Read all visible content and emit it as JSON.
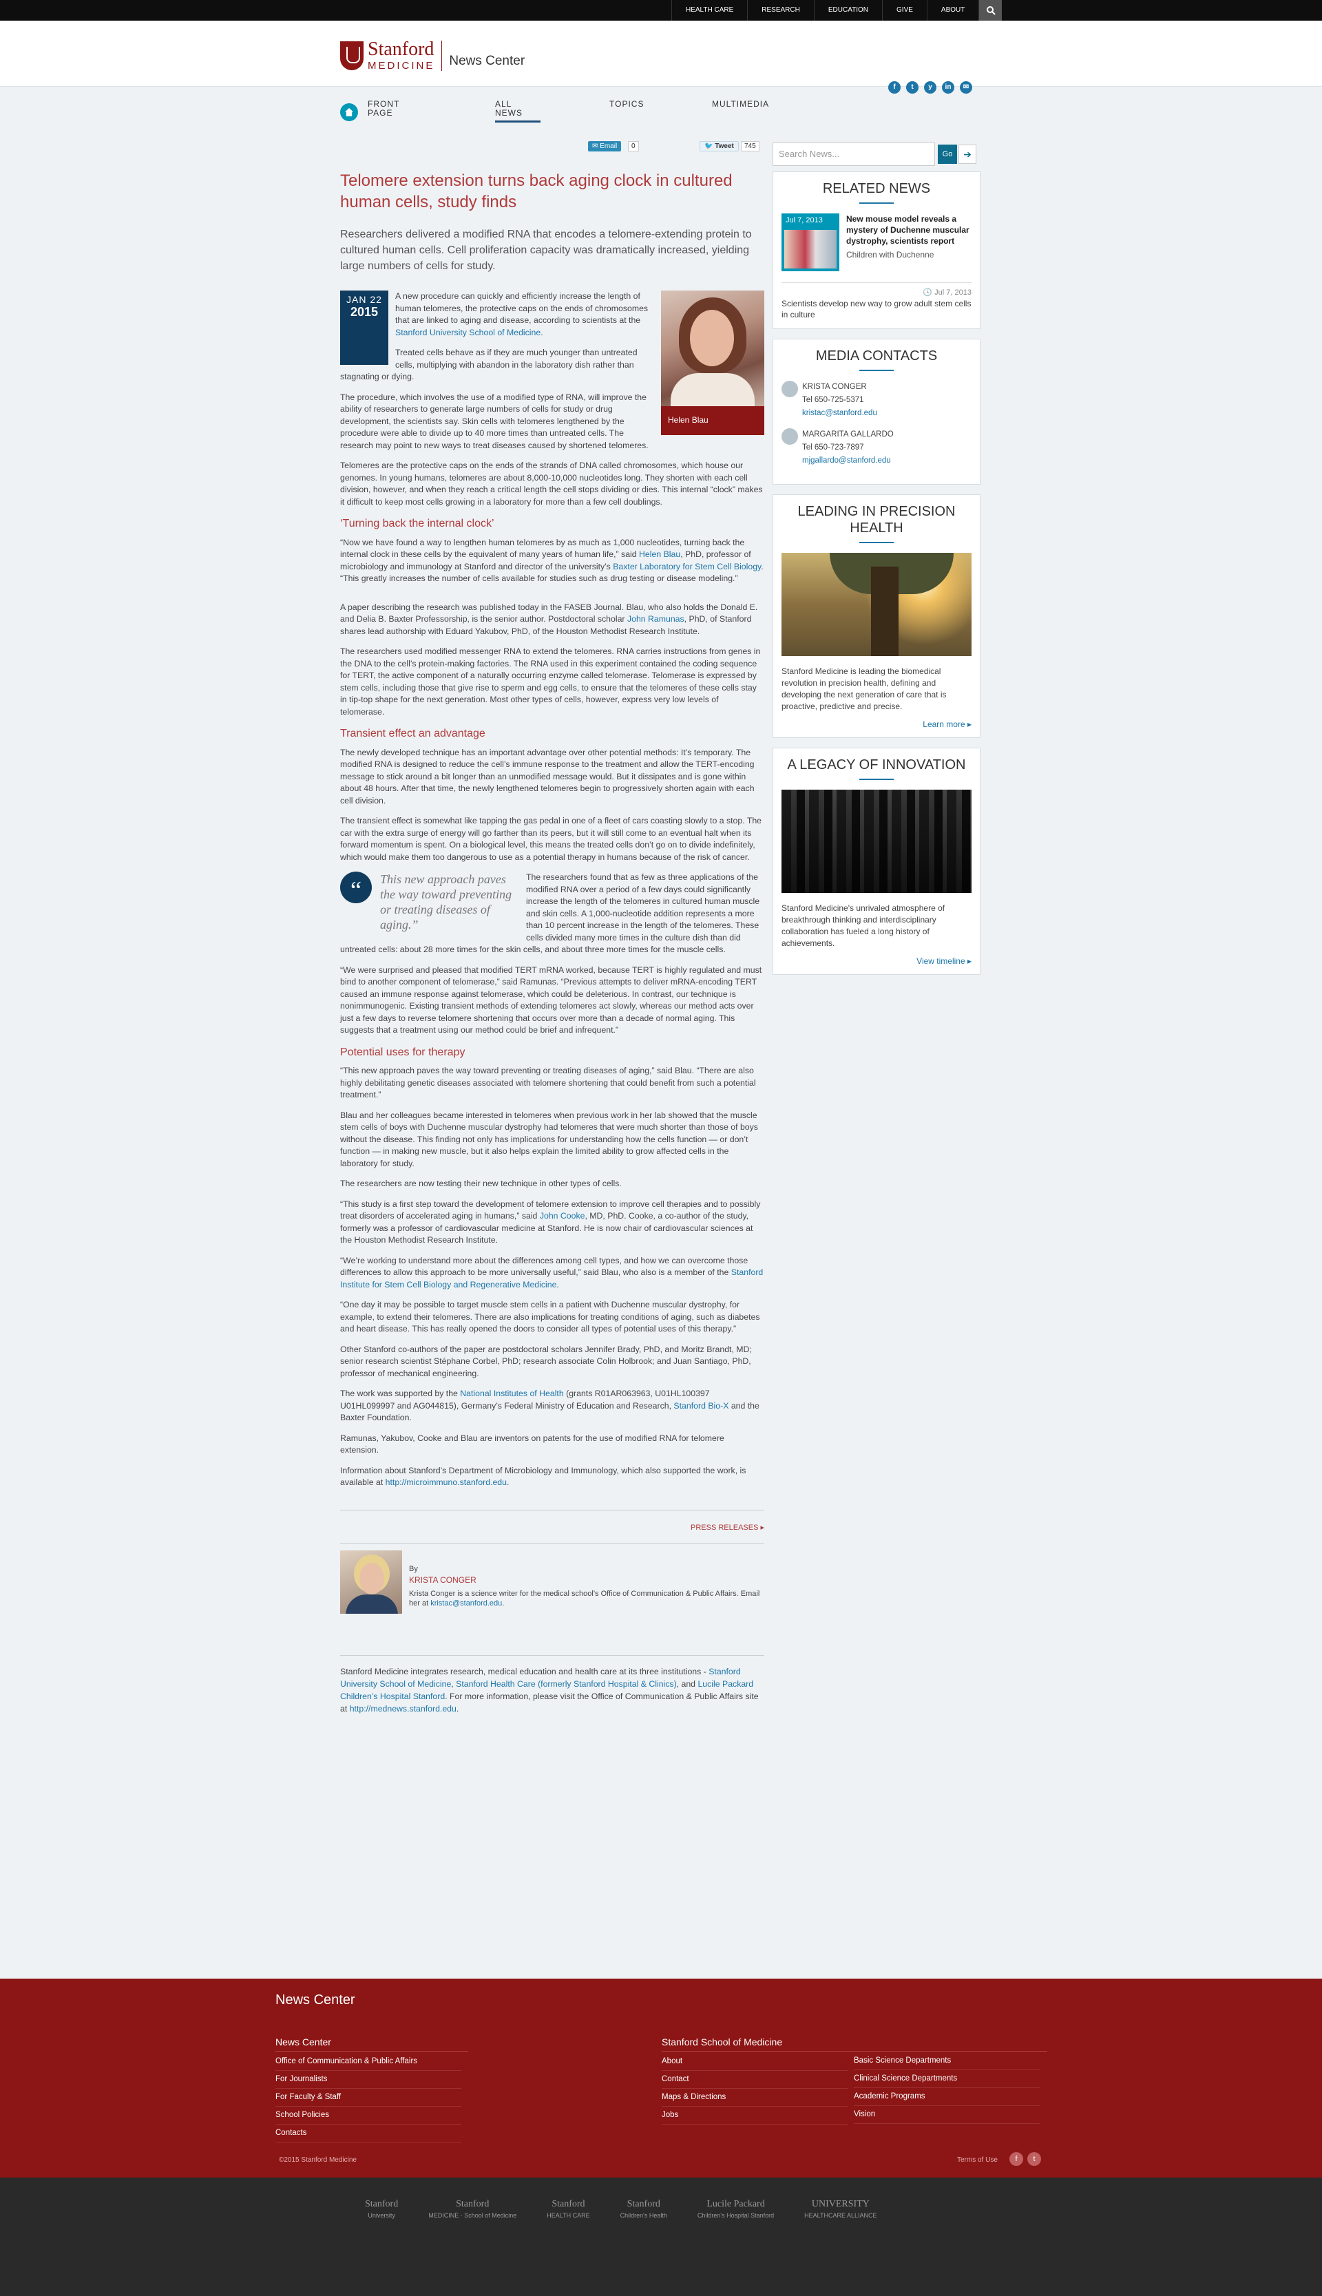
{
  "topnav": [
    "HEALTH CARE",
    "RESEARCH",
    "EDUCATION",
    "GIVE",
    "ABOUT"
  ],
  "logo": {
    "line1": "Stanford",
    "line2": "MEDICINE",
    "section": "News Center"
  },
  "social": [
    "f",
    "t",
    "y",
    "in",
    "✉"
  ],
  "nav": {
    "front_page": "FRONT PAGE",
    "all_news": "ALL NEWS",
    "topics": "TOPICS",
    "multimedia": "MULTIMEDIA"
  },
  "share": {
    "email": "Email",
    "email_count": "0",
    "tweet": "Tweet",
    "tweet_count": "745"
  },
  "article": {
    "title": "Telomere extension turns back aging clock in cultured human cells, study finds",
    "lede": "Researchers delivered a modified RNA that encodes a telomere-extending protein to cultured human cells. Cell proliferation capacity was dramatically increased, yielding large numbers of cells for study.",
    "date_md": "JAN 22",
    "date_yr": "2015",
    "photo_caption": "Helen Blau",
    "p1a": "A new procedure can quickly and efficiently increase the length of human telomeres, the protective caps on the ends of chromosomes that are linked to aging and disease, according to scientists at the ",
    "p1_link": "Stanford University School of Medicine",
    "p1b": ".",
    "p2": "Treated cells behave as if they are much younger than untreated cells, multiplying with abandon in the laboratory dish rather than stagnating or dying.",
    "p3": "The procedure, which involves the use of a modified type of RNA, will improve the ability of researchers to generate large numbers of cells for study or drug development, the scientists say. Skin cells with telomeres lengthened by the procedure were able to divide up to 40 more times than untreated cells. The research may point to new ways to treat diseases caused by shortened telomeres.",
    "p4": "Telomeres are the protective caps on the ends of the strands of DNA called chromosomes, which house our genomes. In young humans, telomeres are about 8,000-10,000 nucleotides long. They shorten with each cell division, however, and when they reach a critical length the cell stops dividing or dies. This internal “clock” makes it difficult to keep most cells growing in a laboratory for more than a few cell doublings.",
    "h_clock": "‘Turning back the internal clock’",
    "p5a": "“Now we have found a way to lengthen human telomeres by as much as 1,000 nucleotides, turning back the internal clock in these cells by the equivalent of many years of human life,” said ",
    "p5_link1": "Helen Blau",
    "p5b": ", PhD, professor of microbiology and immunology at Stanford and director of the university’s ",
    "p5_link2": "Baxter Laboratory for Stem Cell Biology",
    "p5c": ". “This greatly increases the number of cells available for studies such as drug testing or disease modeling.”",
    "p6a": "A paper describing the research was published today in the FASEB Journal. Blau, who also holds the Donald E. and Delia B. Baxter Professorship, is the senior author. Postdoctoral scholar ",
    "p6_link": "John Ramunas",
    "p6b": ", PhD, of Stanford shares lead authorship with Eduard Yakubov, PhD, of the Houston Methodist Research Institute.",
    "p7": "The researchers used modified messenger RNA to extend the telomeres. RNA carries instructions from genes in the DNA to the cell’s protein-making factories. The RNA used in this experiment contained the coding sequence for TERT, the active component of a naturally occurring enzyme called telomerase. Telomerase is expressed by stem cells, including those that give rise to sperm and egg cells, to ensure that the telomeres of these cells stay in tip-top shape for the next generation. Most other types of cells, however, express very low levels of telomerase.",
    "h_transient": "Transient effect an advantage",
    "p8": "The newly developed technique has an important advantage over other potential methods: It’s temporary. The modified RNA is designed to reduce the cell’s immune response to the treatment and allow the TERT-encoding message to stick around a bit longer than an unmodified message would. But it dissipates and is gone within about 48 hours. After that time, the newly lengthened telomeres begin to progressively shorten again with each cell division.",
    "p9": "The transient effect is somewhat like tapping the gas pedal in one of a fleet of cars coasting slowly to a stop. The car with the extra surge of energy will go farther than its peers, but it will still come to an eventual halt when its forward momentum is spent. On a biological level, this means the treated cells don’t go on to divide indefinitely, which would make them too dangerous to use as a potential therapy in humans because of the risk of cancer.",
    "pullquote": "This new approach paves the way toward preventing or treating diseases of aging.”",
    "p10": "The researchers found that as few as three applications of the modified RNA over a period of a few days could significantly increase the length of the telomeres in cultured human muscle and skin cells. A 1,000-nucleotide addition represents a more than 10 percent increase in the length of the telomeres. These cells divided many more times in the culture dish than did untreated cells: about 28 more times for the skin cells, and about three more times for the muscle cells.",
    "p11": "“We were surprised and pleased that modified TERT mRNA worked, because TERT is highly regulated and must bind to another component of telomerase,” said Ramunas. “Previous attempts to deliver mRNA-encoding TERT caused an immune response against telomerase, which could be deleterious. In contrast, our technique is nonimmunogenic. Existing transient methods of extending telomeres act slowly, whereas our method acts over just a few days to reverse telomere shortening that occurs over more than a decade of normal aging. This suggests that a treatment using our method could be brief and infrequent.”",
    "h_potential": "Potential uses for therapy",
    "p12": "“This new approach paves the way toward preventing or treating diseases of aging,” said Blau. “There are also highly debilitating genetic diseases associated with telomere shortening that could benefit from such a potential treatment.”",
    "p13": "Blau and her colleagues became interested in telomeres when previous work in her lab showed that the muscle stem cells of boys with Duchenne muscular dystrophy had telomeres that were much shorter than those of boys without the disease. This finding not only has implications for understanding how the cells function — or don’t function — in making new muscle, but it also helps explain the limited ability to grow affected cells in the laboratory for study.",
    "p14": "The researchers are now testing their new technique in other types of cells.",
    "p15a": "“This study is a first step toward the development of telomere extension to improve cell therapies and to possibly treat disorders of accelerated aging in humans,” said ",
    "p15_link": "John Cooke",
    "p15b": ", MD, PhD. Cooke, a co-author of the study, formerly was a professor of cardiovascular medicine at Stanford. He is now chair of cardiovascular sciences at the Houston Methodist Research Institute.",
    "p16a": "“We’re working to understand more about the differences among cell types, and how we can overcome those differences to allow this approach to be more universally useful,” said Blau, who also is a member of the ",
    "p16_link": "Stanford Institute for Stem Cell Biology and Regenerative Medicine",
    "p16b": ".",
    "p17": "“One day it may be possible to target muscle stem cells in a patient with Duchenne muscular dystrophy, for example, to extend their telomeres. There are also implications for treating conditions of aging, such as diabetes and heart disease. This has really opened the doors to consider all types of potential uses of this therapy.”",
    "p18": "Other Stanford co-authors of the paper are postdoctoral scholars Jennifer Brady, PhD, and Moritz Brandt, MD; senior research scientist Stéphane Corbel, PhD; research associate Colin Holbrook; and Juan Santiago, PhD, professor of mechanical engineering.",
    "p19a": "The work was supported by the ",
    "p19_link1": "National Institutes of Health",
    "p19b": " (grants R01AR063963, U01HL100397 U01HL099997 and AG044815), Germany’s Federal Ministry of Education and Research, ",
    "p19_link2": "Stanford Bio-X",
    "p19c": " and the Baxter Foundation.",
    "p20": "Ramunas, Yakubov, Cooke and Blau are inventors on patents for the use of modified RNA for telomere extension.",
    "p21a": "Information about Stanford’s Department of Microbiology and Immunology, which also supported the work, is available at ",
    "p21_link": "http://microimmuno.stanford.edu",
    "p21b": ".",
    "press": "PRESS RELEASES ▸",
    "by": "By",
    "author": "KRISTA CONGER",
    "author_bio": "Krista Conger is a science writer for the medical school’s Office of Communication & Public Affairs. Email her at ",
    "author_email": "kristac@stanford.edu",
    "note_a": "Stanford Medicine integrates research, medical education and health care at its three institutions - ",
    "note_link1": "Stanford University School of Medicine",
    "note_sep1": ", ",
    "note_link2": "Stanford Health Care (formerly Stanford Hospital & Clinics)",
    "note_sep2": ", and ",
    "note_link3": "Lucile Packard Children’s Hospital Stanford",
    "note_b": ". For more information, please visit the Office of Communication & Public Affairs site at ",
    "note_link4": "http://mednews.stanford.edu",
    "note_c": "."
  },
  "sidebar": {
    "search_placeholder": "Search News...",
    "go": "Go",
    "related_title": "RELATED NEWS",
    "rn1_date": "Jul 7, 2013",
    "rn1_title": "New mouse model reveals a mystery of Duchenne muscular dystrophy, scientists report",
    "rn1_sub": "Children with Duchenne",
    "rn2_date": "Jul 7, 2013",
    "rn2_title": "Scientists develop new way to grow adult stem cells in culture",
    "media_title": "MEDIA CONTACTS",
    "c1_name": "KRISTA CONGER",
    "c1_tel": "Tel 650-725-5371",
    "c1_email": "kristac@stanford.edu",
    "c2_name": "MARGARITA GALLARDO",
    "c2_tel": "Tel 650-723-7897",
    "c2_email": "mjgallardo@stanford.edu",
    "precision_title": "LEADING IN PRECISION HEALTH",
    "precision_text": "Stanford Medicine is leading the biomedical revolution in precision health, defining and developing the next generation of care that is proactive, predictive and precise.",
    "precision_more": "Learn more ▸",
    "legacy_title": "A LEGACY OF INNOVATION",
    "legacy_text": "Stanford Medicine's unrivaled atmosphere of breakthrough thinking and interdisciplinary collaboration has fueled a long history of achievements.",
    "legacy_more": "View timeline ▸"
  },
  "footer": {
    "title": "News Center",
    "col1_head": "News Center",
    "col1": [
      "Office of Communication & Public Affairs",
      "For Journalists",
      "For Faculty & Staff",
      "School Policies",
      "Contacts"
    ],
    "col2_head": "Stanford School of Medicine",
    "col2": [
      "About",
      "Contact",
      "Maps & Directions",
      "Jobs"
    ],
    "col3": [
      "Basic Science Departments",
      "Clinical Science Departments",
      "Academic Programs",
      "Vision"
    ],
    "copyright": "©2015 Stanford Medicine",
    "terms": "Terms of Use",
    "partners": [
      {
        "name": "Stanford",
        "sub": "University"
      },
      {
        "name": "Stanford",
        "sub": "MEDICINE · School of Medicine"
      },
      {
        "name": "Stanford",
        "sub": "HEALTH CARE"
      },
      {
        "name": "Stanford",
        "sub": "Children's Health"
      },
      {
        "name": "Lucile Packard",
        "sub": "Children's Hospital Stanford"
      },
      {
        "name": "UNIVERSITY",
        "sub": "HEALTHCARE ALLIANCE"
      }
    ]
  }
}
